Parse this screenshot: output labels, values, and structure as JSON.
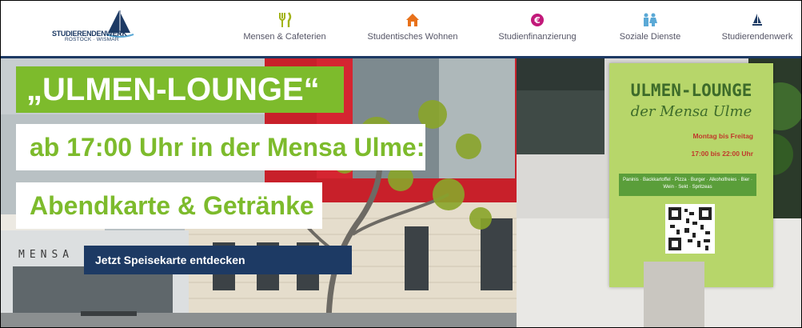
{
  "header": {
    "logo": {
      "line1": "STUDIERENDENWERK",
      "line2": "ROSTOCK · WISMAR"
    },
    "nav": [
      {
        "label": "Mensen & Cafeterien",
        "icon": "cutlery-icon"
      },
      {
        "label": "Studentisches Wohnen",
        "icon": "house-icon"
      },
      {
        "label": "Studienfinanzierung",
        "icon": "euro-icon"
      },
      {
        "label": "Soziale Dienste",
        "icon": "people-icon"
      },
      {
        "label": "Studierendenwerk",
        "icon": "sailboat-icon"
      }
    ]
  },
  "hero": {
    "headline": "„ULMEN-LOUNGE“",
    "line2": "ab 17:00 Uhr in der Mensa Ulme:",
    "line3": "Abendkarte & Getränke",
    "cta": "Jetzt Speisekarte entdecken",
    "building_sign": "MENSA",
    "poster": {
      "title": "ULMEN-LOUNGE",
      "subtitle": "der Mensa Ulme",
      "days": "Montag bis Freitag",
      "hours": "17:00 bis 22:00 Uhr",
      "menu": "Paninis · Backkartoffel · Pizza · Burger · Alkoholfreies · Bier · Wein · Sekt · Spritzeas"
    }
  },
  "colors": {
    "brand_navy": "#1d3a64",
    "accent_green": "#7dbb2c",
    "nav_icon_olive": "#a2b319",
    "nav_icon_orange": "#e8711a",
    "nav_icon_magenta": "#c2197a",
    "nav_icon_blue": "#5ba9d6"
  }
}
